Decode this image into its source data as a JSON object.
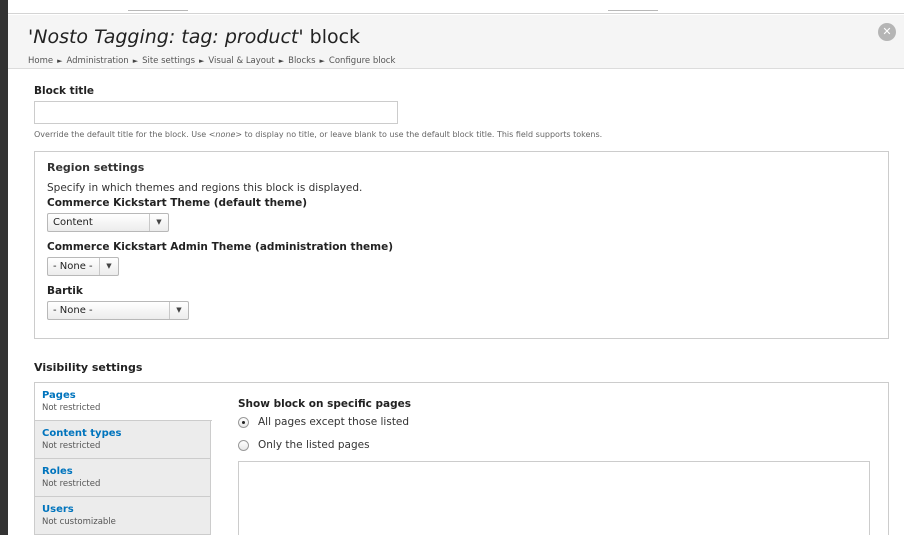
{
  "header": {
    "title_prefix": "'",
    "title_italic": "Nosto Tagging: tag: product",
    "title_suffix": "' block",
    "breadcrumb": [
      "Home",
      "Administration",
      "Site settings",
      "Visual & Layout",
      "Blocks",
      "Configure block"
    ],
    "breadcrumb_separator": "►",
    "close_icon": "close-icon"
  },
  "block_title": {
    "label": "Block title",
    "value": "",
    "description_before": "Override the default title for the block. Use ",
    "description_em": "<none>",
    "description_after": " to display no title, or leave blank to use the default block title. This field supports tokens."
  },
  "region_settings": {
    "legend": "Region settings",
    "description": "Specify in which themes and regions this block is displayed.",
    "themes": [
      {
        "label": "Commerce Kickstart Theme (default theme)",
        "selected": "Content"
      },
      {
        "label": "Commerce Kickstart Admin Theme (administration theme)",
        "selected": "- None -"
      },
      {
        "label": "Bartik",
        "selected": "- None -"
      }
    ],
    "arrow_icon": "▼"
  },
  "visibility": {
    "title": "Visibility settings",
    "tabs": [
      {
        "title": "Pages",
        "summary": "Not restricted",
        "active": true
      },
      {
        "title": "Content types",
        "summary": "Not restricted",
        "active": false
      },
      {
        "title": "Roles",
        "summary": "Not restricted",
        "active": false
      },
      {
        "title": "Users",
        "summary": "Not customizable",
        "active": false
      }
    ],
    "pane": {
      "heading": "Show block on specific pages",
      "options": [
        {
          "label": "All pages except those listed",
          "checked": true
        },
        {
          "label": "Only the listed pages",
          "checked": false
        }
      ],
      "pages_value": ""
    }
  },
  "colors": {
    "link_blue": "#0074bd",
    "header_bg": "#f5f5f5",
    "left_bar": "#333333"
  }
}
